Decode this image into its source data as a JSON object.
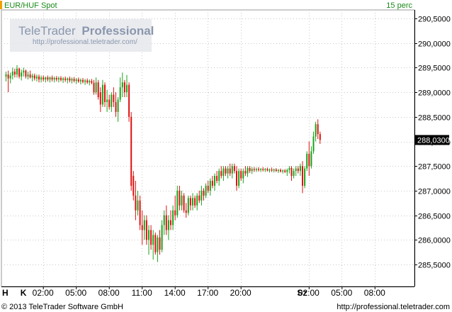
{
  "header": {
    "instrument": "EUR/HUF Spot",
    "interval": "15 perc"
  },
  "watermark": {
    "brand_prefix": "TeleTrader",
    "brand_suffix": "Professional",
    "url": "http://professional.teletrader.com/"
  },
  "footer": {
    "copyright": "© 2013 TeleTrader Software GmbH",
    "url": "http://professional.teletrader.com"
  },
  "colors": {
    "up": "#1aa31a",
    "down": "#e01010",
    "grid": "#c8c8c8",
    "last_badge_bg": "#000000",
    "last_badge_fg": "#ffffff"
  },
  "chart_data": {
    "type": "candlestick",
    "interval": "15 perc",
    "y_axis": {
      "side": "right",
      "ylim": [
        285.25,
        290.75
      ],
      "ticks": [
        285.5,
        286.0,
        286.5,
        287.0,
        287.5,
        288.0,
        288.5,
        289.0,
        289.5,
        290.0,
        290.5
      ],
      "tick_labels": [
        "285,5000",
        "286,0000",
        "286,5000",
        "287,0000",
        "287,5000",
        "288,0000",
        "288,5000",
        "289,0000",
        "289,5000",
        "290,0000",
        "290,5000"
      ]
    },
    "last_value": 288.03,
    "last_value_label": "288,0300",
    "x_axis": {
      "day_labels": [
        {
          "label": "H",
          "slot": 0
        },
        {
          "label": "K",
          "slot": 8
        },
        {
          "label": "Sz",
          "slot": 134
        }
      ],
      "time_labels": [
        {
          "label": "02:00",
          "slot": 17
        },
        {
          "label": "05:00",
          "slot": 32
        },
        {
          "label": "08:00",
          "slot": 47
        },
        {
          "label": "11:00",
          "slot": 62
        },
        {
          "label": "14:00",
          "slot": 77
        },
        {
          "label": "17:00",
          "slot": 92
        },
        {
          "label": "20:00",
          "slot": 107
        },
        {
          "label": "02:00",
          "slot": 138
        },
        {
          "label": "05:00",
          "slot": 153
        },
        {
          "label": "08:00",
          "slot": 168
        }
      ]
    },
    "gridlines": true,
    "candles": [
      [
        289.32,
        289.42,
        289.22,
        289.36
      ],
      [
        289.36,
        289.44,
        289.0,
        289.28
      ],
      [
        289.28,
        289.4,
        289.18,
        289.34
      ],
      [
        289.34,
        289.5,
        289.26,
        289.42
      ],
      [
        289.42,
        289.48,
        289.3,
        289.36
      ],
      [
        289.36,
        289.55,
        289.3,
        289.48
      ],
      [
        289.48,
        289.5,
        289.28,
        289.32
      ],
      [
        289.32,
        289.46,
        289.24,
        289.4
      ],
      [
        289.4,
        289.5,
        289.32,
        289.44
      ],
      [
        289.44,
        289.46,
        289.28,
        289.32
      ],
      [
        289.32,
        289.42,
        289.26,
        289.36
      ],
      [
        289.36,
        289.44,
        289.28,
        289.3
      ],
      [
        289.3,
        289.38,
        289.22,
        289.34
      ],
      [
        289.34,
        289.38,
        289.24,
        289.28
      ],
      [
        289.28,
        289.36,
        289.22,
        289.32
      ],
      [
        289.32,
        289.36,
        289.2,
        289.26
      ],
      [
        289.26,
        289.34,
        289.2,
        289.3
      ],
      [
        289.3,
        289.34,
        289.22,
        289.26
      ],
      [
        289.26,
        289.32,
        289.2,
        289.3
      ],
      [
        289.3,
        289.34,
        289.22,
        289.26
      ],
      [
        289.26,
        289.32,
        289.2,
        289.3
      ],
      [
        289.3,
        289.34,
        289.22,
        289.26
      ],
      [
        289.26,
        289.32,
        289.2,
        289.29
      ],
      [
        289.29,
        289.33,
        289.22,
        289.26
      ],
      [
        289.26,
        289.32,
        289.2,
        289.29
      ],
      [
        289.29,
        289.33,
        289.22,
        289.25
      ],
      [
        289.25,
        289.31,
        289.19,
        289.28
      ],
      [
        289.28,
        289.32,
        289.21,
        289.25
      ],
      [
        289.25,
        289.3,
        289.18,
        289.28
      ],
      [
        289.28,
        289.32,
        289.2,
        289.24
      ],
      [
        289.24,
        289.3,
        289.18,
        289.27
      ],
      [
        289.27,
        289.31,
        289.2,
        289.23
      ],
      [
        289.23,
        289.29,
        289.17,
        289.26
      ],
      [
        289.26,
        289.3,
        289.19,
        289.22
      ],
      [
        289.22,
        289.28,
        289.16,
        289.25
      ],
      [
        289.25,
        289.29,
        289.18,
        289.21
      ],
      [
        289.21,
        289.27,
        289.15,
        289.24
      ],
      [
        289.24,
        289.28,
        289.17,
        289.2
      ],
      [
        289.2,
        289.26,
        289.14,
        289.23
      ],
      [
        289.23,
        289.27,
        289.16,
        289.19
      ],
      [
        289.19,
        289.25,
        288.95,
        289.0
      ],
      [
        289.0,
        289.3,
        288.95,
        289.2
      ],
      [
        289.2,
        289.25,
        288.85,
        288.9
      ],
      [
        289.0,
        289.1,
        288.6,
        288.75
      ],
      [
        288.75,
        289.25,
        288.7,
        289.15
      ],
      [
        289.15,
        289.2,
        288.7,
        288.8
      ],
      [
        288.8,
        289.05,
        288.6,
        288.85
      ],
      [
        288.85,
        288.95,
        288.65,
        288.7
      ],
      [
        288.7,
        289.0,
        288.6,
        288.95
      ],
      [
        288.95,
        289.1,
        288.7,
        288.8
      ],
      [
        288.8,
        289.0,
        288.5,
        288.6
      ],
      [
        288.6,
        288.9,
        288.4,
        288.85
      ],
      [
        288.85,
        289.3,
        288.8,
        289.1
      ],
      [
        289.1,
        289.4,
        288.9,
        289.2
      ],
      [
        289.2,
        289.25,
        288.9,
        289.0
      ],
      [
        289.0,
        289.35,
        288.9,
        289.15
      ],
      [
        289.15,
        289.2,
        288.4,
        288.5
      ],
      [
        288.5,
        288.6,
        287.0,
        287.1
      ],
      [
        287.3,
        287.4,
        286.8,
        286.9
      ],
      [
        286.9,
        287.2,
        286.4,
        286.6
      ],
      [
        286.6,
        287.0,
        286.5,
        286.8
      ],
      [
        286.8,
        286.9,
        286.2,
        286.3
      ],
      [
        286.3,
        286.6,
        285.9,
        286.2
      ],
      [
        286.2,
        286.5,
        286.0,
        286.4
      ],
      [
        286.4,
        286.5,
        285.9,
        286.0
      ],
      [
        286.0,
        286.3,
        285.7,
        286.2
      ],
      [
        286.2,
        286.3,
        285.8,
        285.9
      ],
      [
        285.9,
        286.2,
        285.6,
        286.1
      ],
      [
        286.1,
        286.15,
        285.7,
        285.75
      ],
      [
        285.75,
        286.1,
        285.55,
        286.05
      ],
      [
        286.05,
        286.2,
        285.7,
        285.8
      ],
      [
        285.8,
        286.4,
        285.75,
        286.3
      ],
      [
        286.3,
        286.6,
        286.1,
        286.5
      ],
      [
        286.5,
        286.7,
        286.1,
        286.2
      ],
      [
        286.2,
        286.5,
        286.0,
        286.4
      ],
      [
        286.4,
        286.6,
        286.2,
        286.3
      ],
      [
        286.3,
        286.7,
        286.2,
        286.6
      ],
      [
        286.6,
        286.9,
        286.4,
        286.5
      ],
      [
        286.5,
        287.1,
        286.45,
        287.0
      ],
      [
        287.0,
        287.1,
        286.6,
        286.7
      ],
      [
        286.7,
        287.0,
        286.6,
        286.9
      ],
      [
        286.9,
        286.95,
        286.55,
        286.6
      ],
      [
        286.6,
        286.75,
        286.45,
        286.55
      ],
      [
        286.55,
        286.9,
        286.5,
        286.85
      ],
      [
        286.85,
        286.9,
        286.6,
        286.7
      ],
      [
        286.7,
        286.95,
        286.6,
        286.85
      ],
      [
        286.85,
        286.9,
        286.65,
        286.7
      ],
      [
        286.7,
        286.95,
        286.6,
        286.9
      ],
      [
        286.9,
        287.0,
        286.75,
        286.8
      ],
      [
        286.8,
        287.1,
        286.7,
        287.0
      ],
      [
        287.0,
        287.05,
        286.8,
        286.9
      ],
      [
        286.9,
        287.15,
        286.85,
        287.1
      ],
      [
        287.1,
        287.2,
        286.95,
        287.0
      ],
      [
        287.0,
        287.25,
        286.9,
        287.2
      ],
      [
        287.2,
        287.3,
        287.05,
        287.1
      ],
      [
        287.1,
        287.35,
        287.0,
        287.3
      ],
      [
        287.3,
        287.4,
        287.15,
        287.2
      ],
      [
        287.2,
        287.45,
        287.1,
        287.4
      ],
      [
        287.4,
        287.5,
        287.25,
        287.3
      ],
      [
        287.3,
        287.5,
        287.2,
        287.45
      ],
      [
        287.45,
        287.5,
        287.3,
        287.35
      ],
      [
        287.35,
        287.5,
        287.25,
        287.45
      ],
      [
        287.45,
        287.55,
        287.3,
        287.35
      ],
      [
        287.35,
        287.55,
        287.25,
        287.5
      ],
      [
        287.5,
        287.55,
        287.35,
        287.4
      ],
      [
        287.4,
        287.5,
        287.0,
        287.1
      ],
      [
        287.1,
        287.45,
        287.05,
        287.4
      ],
      [
        287.4,
        287.45,
        287.2,
        287.25
      ],
      [
        287.25,
        287.45,
        287.15,
        287.4
      ],
      [
        287.4,
        287.5,
        287.3,
        287.35
      ],
      [
        287.35,
        287.5,
        287.28,
        287.46
      ],
      [
        287.46,
        287.5,
        287.36,
        287.4
      ],
      [
        287.4,
        287.48,
        287.34,
        287.44
      ],
      [
        287.44,
        287.48,
        287.38,
        287.42
      ],
      [
        287.42,
        287.47,
        287.38,
        287.44
      ],
      [
        287.44,
        287.48,
        287.39,
        287.42
      ],
      [
        287.42,
        287.46,
        287.38,
        287.44
      ],
      [
        287.44,
        287.48,
        287.39,
        287.42
      ],
      [
        287.42,
        287.46,
        287.38,
        287.44
      ],
      [
        287.44,
        287.47,
        287.39,
        287.41
      ],
      [
        287.41,
        287.45,
        287.37,
        287.43
      ],
      [
        287.43,
        287.47,
        287.38,
        287.41
      ],
      [
        287.41,
        287.45,
        287.37,
        287.43
      ],
      [
        287.43,
        287.46,
        287.38,
        287.4
      ],
      [
        287.4,
        287.44,
        287.36,
        287.42
      ],
      [
        287.42,
        287.45,
        287.37,
        287.39
      ],
      [
        287.39,
        287.43,
        287.35,
        287.41
      ],
      [
        287.41,
        287.44,
        287.36,
        287.38
      ],
      [
        287.38,
        287.45,
        287.3,
        287.42
      ],
      [
        287.42,
        287.5,
        287.35,
        287.46
      ],
      [
        287.46,
        287.5,
        287.2,
        287.3
      ],
      [
        287.3,
        287.45,
        287.25,
        287.4
      ],
      [
        287.4,
        287.5,
        287.3,
        287.45
      ],
      [
        287.45,
        287.5,
        287.35,
        287.4
      ],
      [
        287.4,
        287.55,
        287.3,
        287.5
      ],
      [
        287.5,
        287.6,
        286.95,
        287.1
      ],
      [
        287.1,
        287.5,
        287.05,
        287.45
      ],
      [
        287.45,
        287.8,
        287.4,
        287.75
      ],
      [
        287.75,
        288.0,
        287.3,
        287.5
      ],
      [
        287.5,
        287.9,
        287.45,
        287.8
      ],
      [
        287.8,
        288.2,
        287.75,
        288.1
      ],
      [
        288.1,
        288.4,
        288.0,
        288.35
      ],
      [
        288.35,
        288.45,
        288.05,
        288.15
      ],
      [
        288.15,
        288.2,
        287.95,
        288.03
      ]
    ]
  }
}
